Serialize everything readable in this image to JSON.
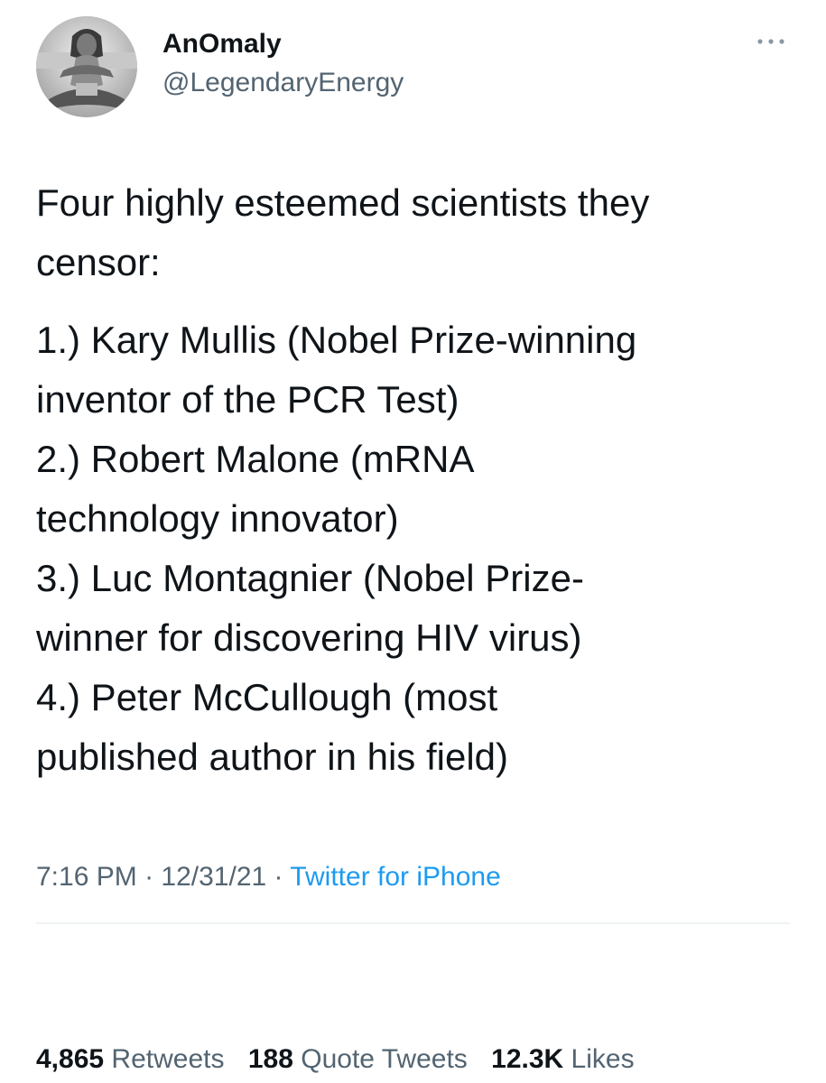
{
  "author": {
    "name": "AnOmaly",
    "handle": "@LegendaryEnergy"
  },
  "tweet": {
    "lines": [
      "Four highly esteemed scientists they",
      "censor:",
      "1.) Kary Mullis (Nobel Prize-winning",
      "inventor of the PCR Test)",
      "2.) Robert Malone (mRNA",
      "technology innovator)",
      "3.) Luc Montagnier (Nobel Prize-",
      "winner for discovering HIV virus)",
      "4.) Peter McCullough (most",
      "published author in his field)"
    ]
  },
  "meta": {
    "time": "7:16 PM",
    "date": "12/31/21",
    "separator": "·",
    "source": "Twitter for iPhone"
  },
  "stats": {
    "retweets_count": "4,865",
    "retweets_label": "Retweets",
    "quotes_count": "188",
    "quotes_label": "Quote Tweets",
    "likes_count": "12.3K",
    "likes_label": "Likes"
  },
  "icons": {
    "more": "more-dots-icon",
    "avatar": "profile-photo"
  },
  "colors": {
    "text": "#0f1419",
    "secondary": "#536471",
    "link": "#1d9bf0",
    "divider": "#eff3f4"
  }
}
